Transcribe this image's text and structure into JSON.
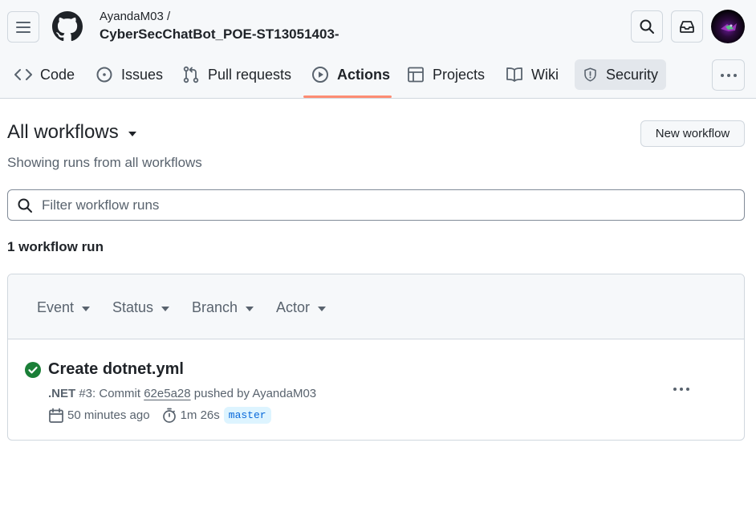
{
  "repo": {
    "owner": "AyandaM03 /",
    "name": "CyberSecChatBot_POE-ST13051403-"
  },
  "tabs": [
    {
      "label": "Code",
      "icon": "code-icon"
    },
    {
      "label": "Issues",
      "icon": "issue-icon"
    },
    {
      "label": "Pull requests",
      "icon": "pull-request-icon"
    },
    {
      "label": "Actions",
      "icon": "play-icon"
    },
    {
      "label": "Projects",
      "icon": "table-icon"
    },
    {
      "label": "Wiki",
      "icon": "book-icon"
    },
    {
      "label": "Security",
      "icon": "shield-icon"
    }
  ],
  "main": {
    "title": "All workflows",
    "subtitle": "Showing runs from all workflows",
    "new_workflow_label": "New workflow",
    "filter_placeholder": "Filter workflow runs",
    "run_count": "1 workflow run"
  },
  "filters": [
    "Event",
    "Status",
    "Branch",
    "Actor"
  ],
  "runs": [
    {
      "title": "Create dotnet.yml",
      "workflow": ".NET",
      "run_number": "#3",
      "commit_prefix": ": Commit",
      "commit_sha": "62e5a28",
      "pushed_by": "pushed by AyandaM03",
      "time_ago": "50 minutes ago",
      "duration": "1m 26s",
      "branch": "master",
      "status": "success"
    }
  ],
  "colors": {
    "success": "#1a7f37",
    "active_tab_underline": "#fd8c73",
    "branch_bg": "#ddf4ff",
    "branch_fg": "#0969da"
  }
}
